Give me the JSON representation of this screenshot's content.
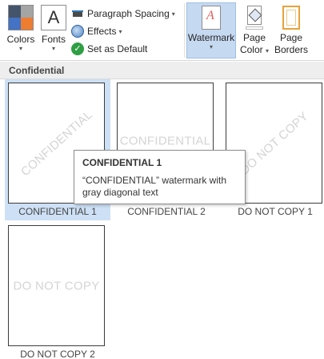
{
  "ribbon": {
    "colors_label": "Colors",
    "fonts_label": "Fonts",
    "fonts_glyph": "A",
    "paragraph_spacing_label": "Paragraph Spacing",
    "effects_label": "Effects",
    "set_default_label": "Set as Default",
    "watermark_label": "Watermark",
    "page_color_label_1": "Page",
    "page_color_label_2": "Color",
    "page_borders_label_1": "Page",
    "page_borders_label_2": "Borders",
    "dropdown_glyph": "▾",
    "check_glyph": "✓"
  },
  "gallery": {
    "section_title": "Confidential",
    "items": [
      {
        "caption": "CONFIDENTIAL 1",
        "watermark_text": "CONFIDENTIAL",
        "orientation": "diagonal",
        "selected": true
      },
      {
        "caption": "CONFIDENTIAL 2",
        "watermark_text": "CONFIDENTIAL",
        "orientation": "horizontal",
        "selected": false
      },
      {
        "caption": "DO NOT COPY 1",
        "watermark_text": "DO NOT COPY",
        "orientation": "diagonal",
        "selected": false
      },
      {
        "caption": "DO NOT COPY 2",
        "watermark_text": "DO NOT COPY",
        "orientation": "horizontal",
        "selected": false
      }
    ]
  },
  "tooltip": {
    "title": "CONFIDENTIAL 1",
    "description": "“CONFIDENTIAL” watermark with gray diagonal text"
  },
  "colors": {
    "selected_tile_bg": "#cde0f5",
    "active_button_bg": "#c5d9f1",
    "watermark_gray": "#d4d4d4"
  }
}
